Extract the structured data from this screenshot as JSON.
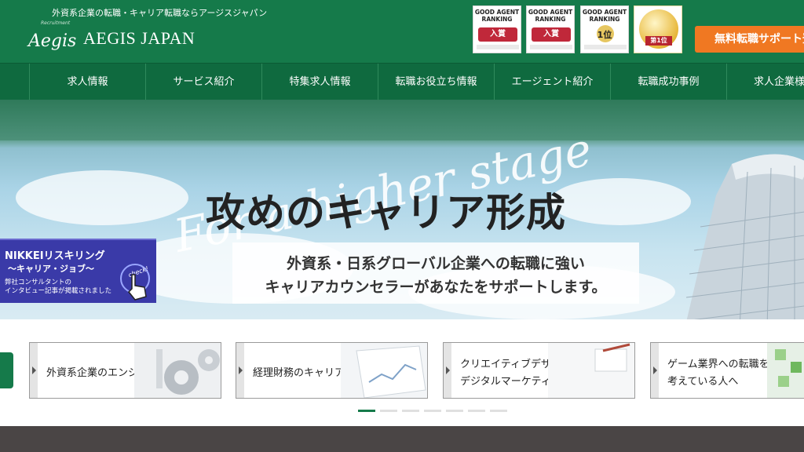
{
  "header": {
    "tagline": "外資系企業の転職・キャリア転職ならアージスジャパン",
    "logo_script": "Aegis",
    "logo_small": "Recruitment",
    "logo_text": "AEGIS JAPAN",
    "badges": [
      {
        "title": "GOOD AGENT RANKING",
        "mark": "入賞"
      },
      {
        "title": "GOOD AGENT RANKING",
        "mark": "入賞"
      },
      {
        "title": "GOOD AGENT RANKING",
        "mark": "1位"
      },
      {
        "title": "",
        "mark": "第1位"
      }
    ],
    "cta_label": "無料転職サポート登"
  },
  "nav": {
    "items": [
      {
        "label": "求人情報"
      },
      {
        "label": "サービス紹介"
      },
      {
        "label": "特集求人情報"
      },
      {
        "label": "転職お役立ち情報"
      },
      {
        "label": "エージェント紹介"
      },
      {
        "label": "転職成功事例"
      },
      {
        "label": "求人企業様"
      }
    ]
  },
  "hero": {
    "script": "For a higher stage",
    "headline": "攻めのキャリア形成",
    "sub_line1": "外資系・日系グローバル企業への転職に強い",
    "sub_line2": "キャリアカウンセラーがあなたをサポートします。",
    "nikkei_title": "NIKKEIリスキリング",
    "nikkei_sub": "～キャリア・ジョブ～",
    "nikkei_note1": "弊社コンサルタントの",
    "nikkei_note2": "インタビュー記事が掲載されました",
    "check_label": "check!"
  },
  "cards": [
    {
      "line1": "外資系企業のエンジニア",
      "line2": ""
    },
    {
      "line1": "経理財務のキャリア転職",
      "line2": ""
    },
    {
      "line1": "クリエイティブデザイナーや",
      "line2": "デジタルマーケティングの転職市場"
    },
    {
      "line1": "ゲーム業界への転職を",
      "line2": "考えている人へ"
    }
  ],
  "carousel": {
    "count": 7,
    "active": 0
  },
  "colors": {
    "brand_green": "#157a4a",
    "nav_green": "#0f6a3f",
    "cta_orange": "#f07822",
    "nikkei_blue": "#3a3aa8"
  }
}
